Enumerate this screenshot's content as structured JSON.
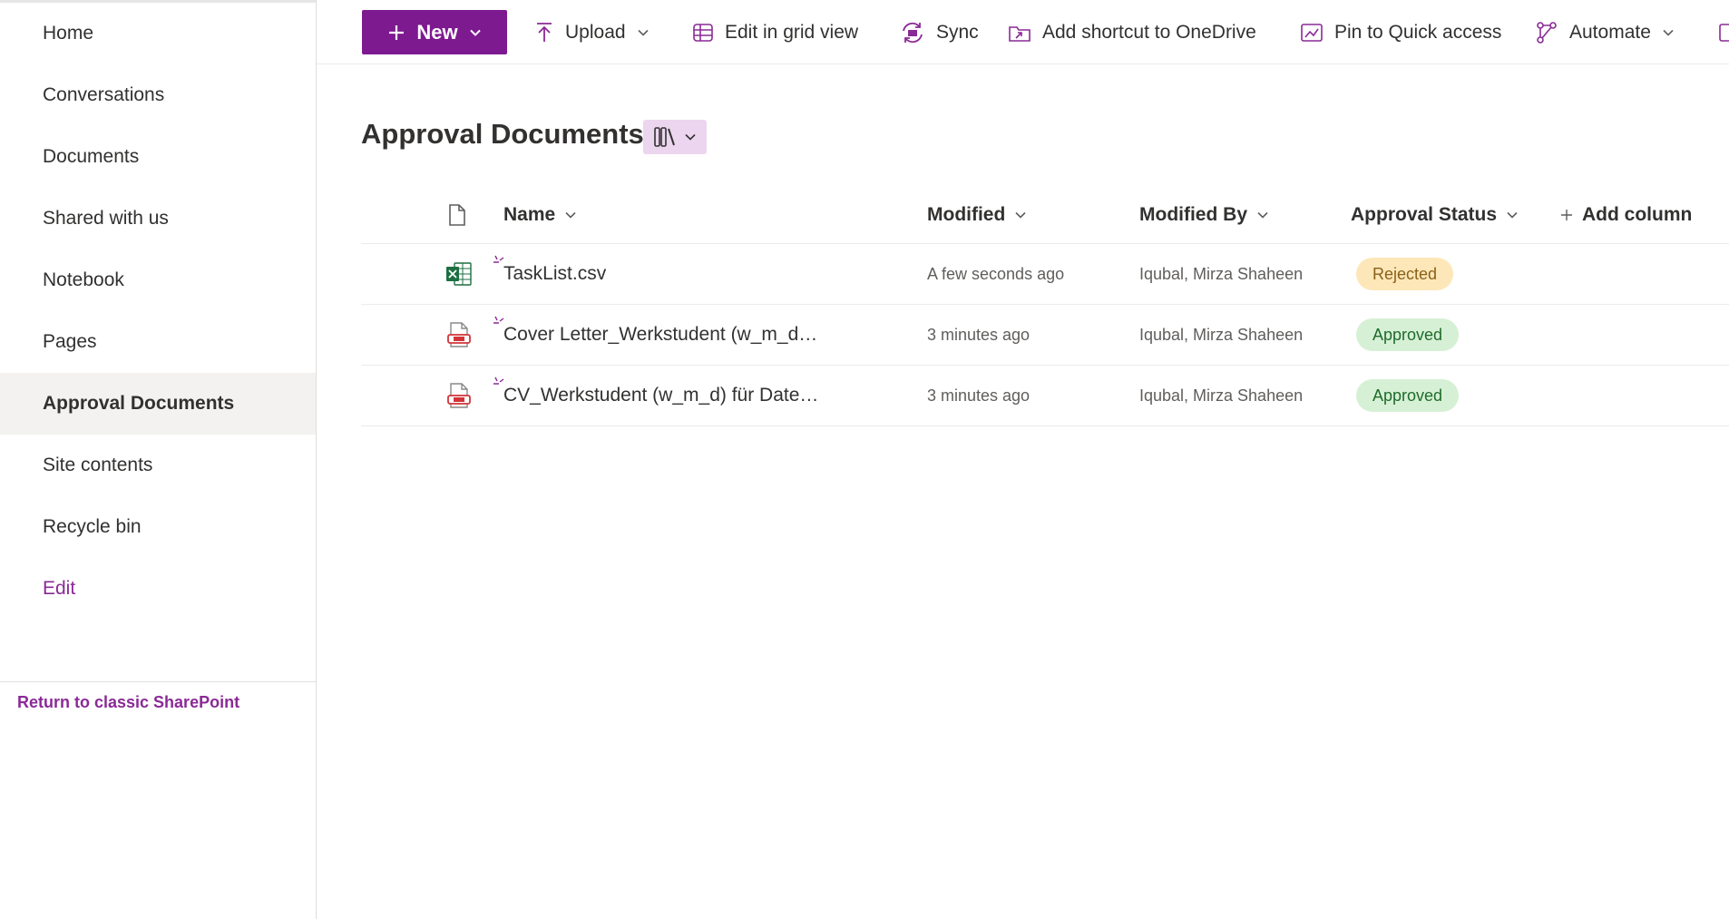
{
  "sidebar": {
    "items": [
      {
        "label": "Home"
      },
      {
        "label": "Conversations"
      },
      {
        "label": "Documents"
      },
      {
        "label": "Shared with us"
      },
      {
        "label": "Notebook"
      },
      {
        "label": "Pages"
      },
      {
        "label": "Approval Documents",
        "active": true
      },
      {
        "label": "Site contents"
      },
      {
        "label": "Recycle bin"
      },
      {
        "label": "Edit"
      }
    ],
    "return_classic": "Return to classic SharePoint"
  },
  "commandbar": {
    "new_label": "New",
    "upload_label": "Upload",
    "grid_view_label": "Edit in grid view",
    "sync_label": "Sync",
    "shortcut_label": "Add shortcut to OneDrive",
    "pin_label": "Pin to Quick access",
    "automate_label": "Automate"
  },
  "library": {
    "title": "Approval Documents",
    "columns": {
      "name": "Name",
      "modified": "Modified",
      "modified_by": "Modified By",
      "approval_status": "Approval Status",
      "add_column": "Add column"
    },
    "rows": [
      {
        "type": "excel-icon",
        "name": "TaskList.csv",
        "modified": "A few seconds ago",
        "modified_by": "Iqubal, Mirza Shaheen",
        "status": "Rejected"
      },
      {
        "type": "pdf-icon",
        "name": "Cover Letter_Werkstudent (w_m_d) für Date...",
        "modified": "3 minutes ago",
        "modified_by": "Iqubal, Mirza Shaheen",
        "status": "Approved"
      },
      {
        "type": "pdf-icon",
        "name": "CV_Werkstudent (w_m_d) für Datenbanksys...",
        "modified": "3 minutes ago",
        "modified_by": "Iqubal, Mirza Shaheen",
        "status": "Approved"
      }
    ]
  },
  "colors": {
    "accent": "#7d1a90",
    "link": "#8a2a96",
    "rejected_bg": "#fde7b9",
    "approved_bg": "#d6f0d6"
  }
}
